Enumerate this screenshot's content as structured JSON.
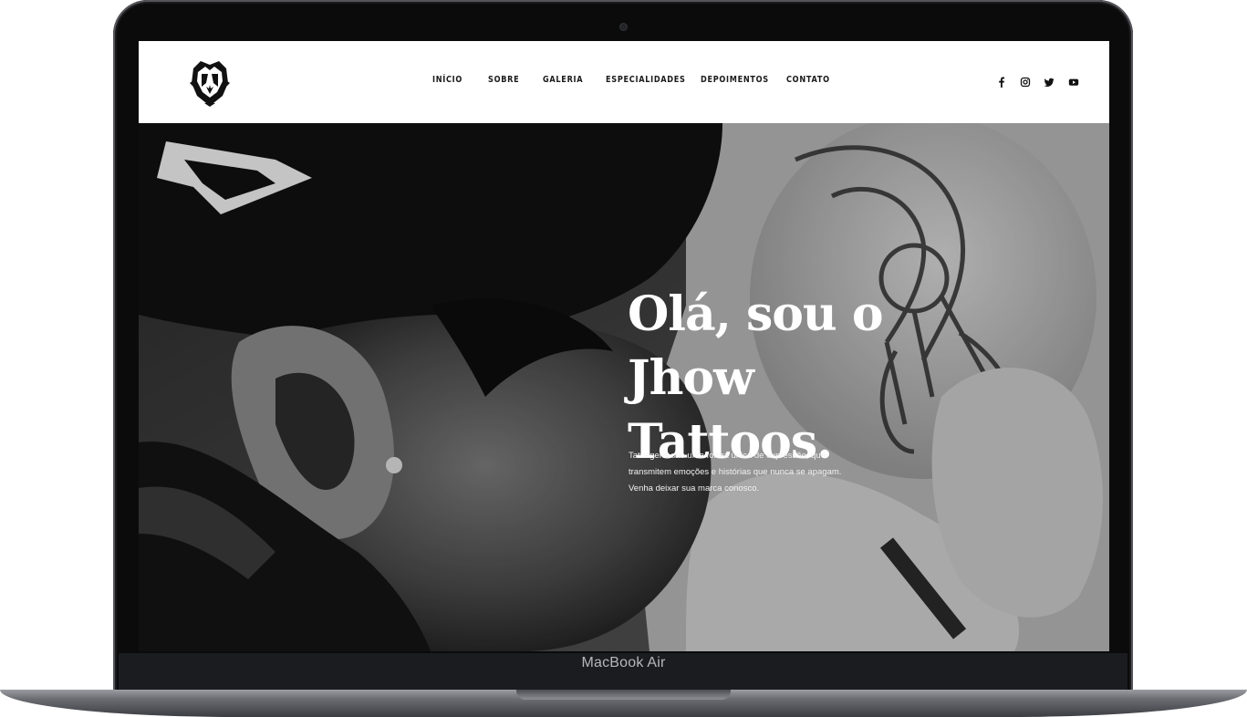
{
  "device": {
    "label": "MacBook Air"
  },
  "nav": {
    "items": [
      {
        "label": "INÍCIO"
      },
      {
        "label": "SOBRE"
      },
      {
        "label": "GALERIA"
      },
      {
        "label": "ESPECIALIDADES"
      },
      {
        "label": "DEPOIMENTOS"
      },
      {
        "label": "CONTATO"
      }
    ]
  },
  "social": [
    "facebook-icon",
    "instagram-icon",
    "twitter-icon",
    "youtube-icon"
  ],
  "hero": {
    "title_lines": [
      "Olá, sou o",
      "Jhow",
      "Tattoos."
    ],
    "text_lines": [
      "Tatuagens são uma forma única de expressão, que",
      "transmitem emoções e histórias que nunca se apagam.",
      "Venha deixar sua marca conosco."
    ]
  },
  "colors": {
    "header_bg": "#ffffff",
    "nav_text": "#1b1b1b",
    "hero_text": "#ffffff"
  }
}
